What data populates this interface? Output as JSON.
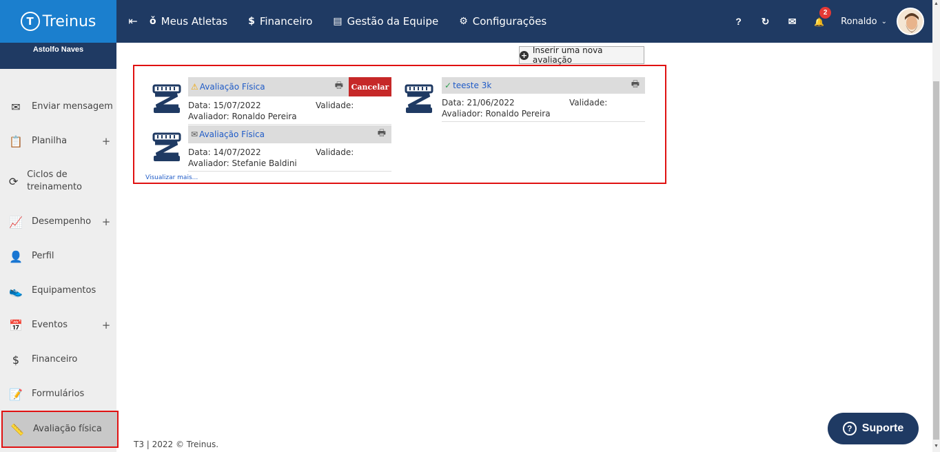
{
  "brand": {
    "name": "Treinus",
    "logo_glyph": "T"
  },
  "topbar": {
    "nav": [
      {
        "label": "Meus Atletas",
        "icon": "medal-icon",
        "glyph": "ǒ"
      },
      {
        "label": "Financeiro",
        "icon": "dollar-icon",
        "glyph": "$"
      },
      {
        "label": "Gestão da Equipe",
        "icon": "contact-card-icon",
        "glyph": "▤"
      },
      {
        "label": "Configurações",
        "icon": "gears-icon",
        "glyph": "⚙"
      }
    ],
    "help_glyph": "?",
    "sync_glyph": "↻",
    "mail_glyph": "✉",
    "bell_glyph": "🔔",
    "notification_count": "2",
    "user_name": "Ronaldo",
    "caret": "⌄"
  },
  "sidebar": {
    "athlete_name": "Astolfo Naves",
    "items": [
      {
        "label": "Enviar mensagem",
        "icon": "envelope-icon",
        "glyph": "✉",
        "expand": ""
      },
      {
        "label": "Planilha",
        "icon": "clipboard-icon",
        "glyph": "📋",
        "expand": "+"
      },
      {
        "label": "Ciclos de treinamento",
        "icon": "cycle-icon",
        "glyph": "⟳",
        "expand": ""
      },
      {
        "label": "Desempenho",
        "icon": "chart-line-icon",
        "glyph": "📈",
        "expand": "+"
      },
      {
        "label": "Perfil",
        "icon": "user-icon",
        "glyph": "👤",
        "expand": ""
      },
      {
        "label": "Equipamentos",
        "icon": "shoe-icon",
        "glyph": "👟",
        "expand": ""
      },
      {
        "label": "Eventos",
        "icon": "calendar-icon",
        "glyph": "📅",
        "expand": "+"
      },
      {
        "label": "Financeiro",
        "icon": "dollar-icon",
        "glyph": "$",
        "expand": ""
      },
      {
        "label": "Formulários",
        "icon": "form-edit-icon",
        "glyph": "📝",
        "expand": ""
      },
      {
        "label": "Avaliação física",
        "icon": "measure-tape-icon",
        "glyph": "📏",
        "expand": ""
      }
    ]
  },
  "main": {
    "new_evaluation_label": "Inserir uma nova avaliação",
    "evaluations": [
      {
        "title": "Avaliação Física",
        "status_icon": "warning-icon",
        "status_glyph": "⚠",
        "status_color": "#f0a500",
        "date": "Data: 15/07/2022",
        "validity": "Validade:",
        "evaluator": "Avaliador: Ronaldo Pereira",
        "cancel_label": "Cancelar"
      },
      {
        "title": "teeste 3k",
        "status_icon": "check-icon",
        "status_glyph": "✓",
        "status_color": "#2e9e4f",
        "date": "Data: 21/06/2022",
        "validity": "Validade:",
        "evaluator": "Avaliador: Ronaldo Pereira"
      },
      {
        "title": "Avaliação Física",
        "status_icon": "envelope-icon",
        "status_glyph": "✉",
        "status_color": "#555555",
        "date": "Data: 14/07/2022",
        "validity": "Validade:",
        "evaluator": "Avaliador: Stefanie Baldini"
      }
    ],
    "see_more": "Visualizar mais...",
    "print_glyph": "🖶"
  },
  "footer": {
    "text": "T3 | 2022 © Treinus."
  },
  "support": {
    "label": "Suporte",
    "glyph": "?"
  },
  "colors": {
    "brand_blue": "#1b7fce",
    "navy": "#1f3a63",
    "accent_red": "#e01010",
    "cancel_red": "#c62828",
    "link_blue": "#1f5bc7"
  }
}
